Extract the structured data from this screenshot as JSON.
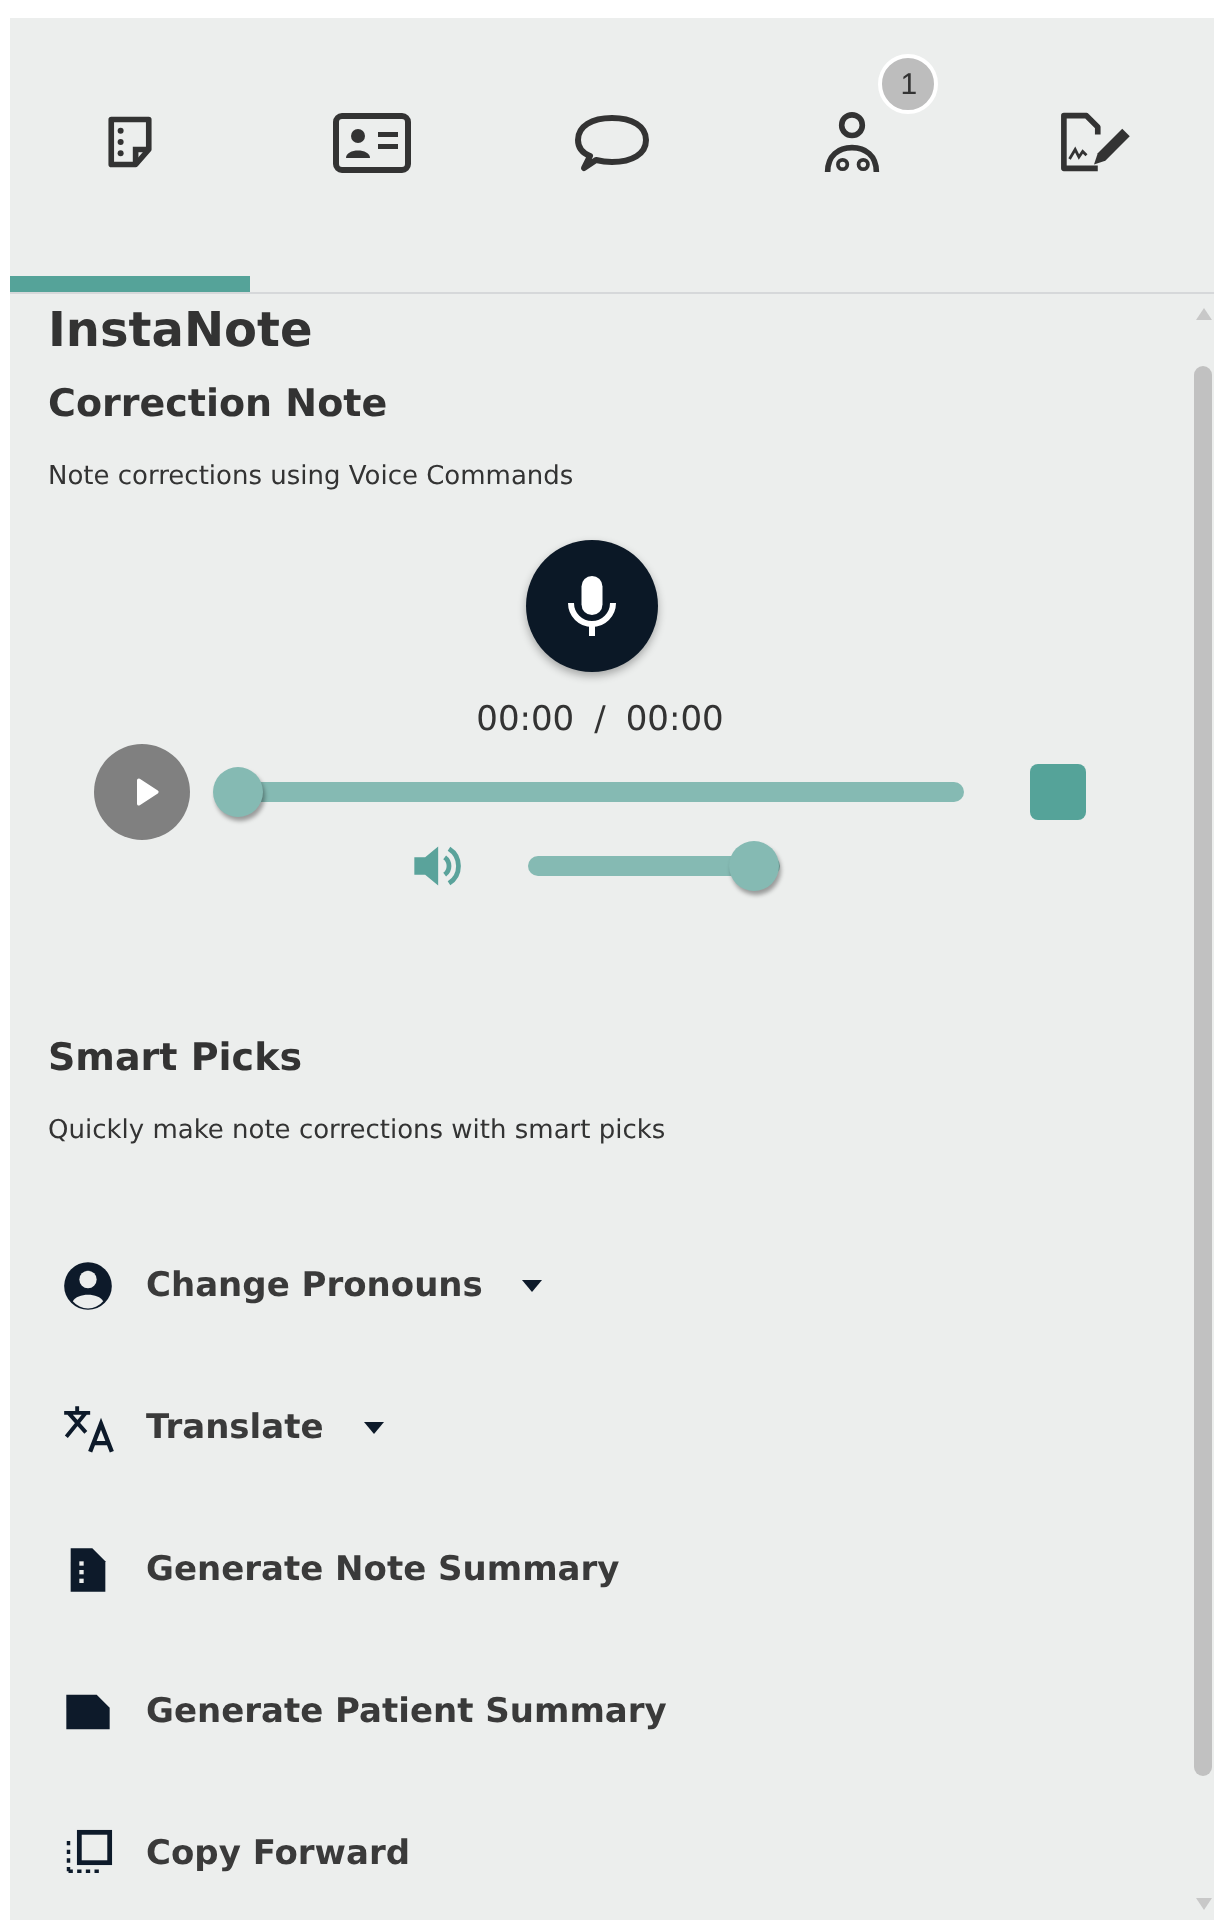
{
  "tabs": [
    {
      "kind": "note",
      "selected": true
    },
    {
      "kind": "id-card",
      "selected": false
    },
    {
      "kind": "chat",
      "selected": false
    },
    {
      "kind": "doctor",
      "selected": false,
      "badge": "1"
    },
    {
      "kind": "signature",
      "selected": false
    }
  ],
  "title": "InstaNote",
  "correction": {
    "heading": "Correction Note",
    "description": "Note corrections using Voice Commands"
  },
  "player": {
    "elapsed": "00:00",
    "separator": "/",
    "total": "00:00",
    "progress": {
      "level": 0
    },
    "volume": {
      "level": 0.9
    }
  },
  "smart_picks": {
    "heading": "Smart Picks",
    "description": "Quickly make note corrections with smart picks",
    "items": [
      {
        "kind": "person",
        "label": "Change Pronouns",
        "dropdown": true
      },
      {
        "kind": "translate",
        "label": "Translate",
        "dropdown": true
      },
      {
        "kind": "note-file",
        "label": "Generate Note Summary",
        "dropdown": false
      },
      {
        "kind": "file",
        "label": "Generate Patient Summary",
        "dropdown": false
      },
      {
        "kind": "copy",
        "label": "Copy Forward",
        "dropdown": false
      }
    ]
  }
}
